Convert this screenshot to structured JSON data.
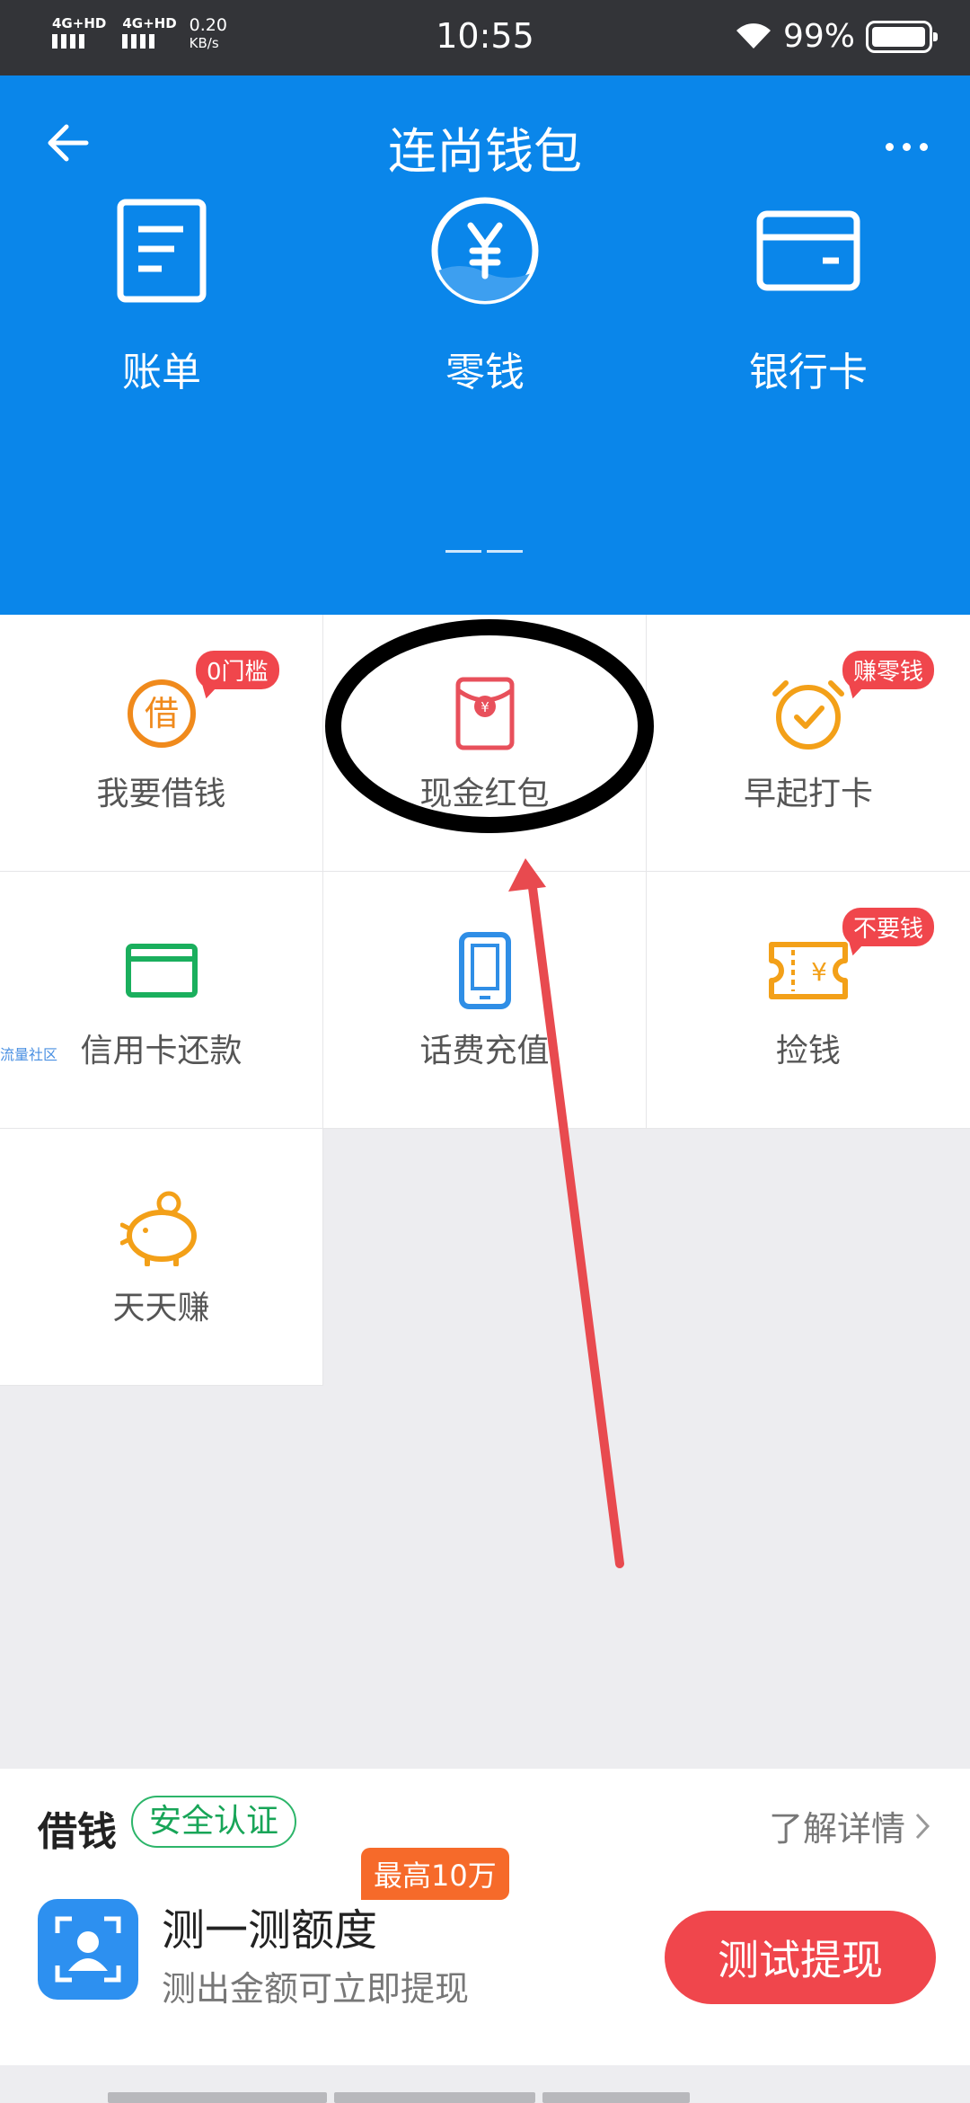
{
  "status_bar": {
    "time": "10:55",
    "net1": "4G+HD",
    "net2": "4G+HD",
    "speed": "0.20",
    "speed_unit": "KB/s",
    "battery": "99%",
    "battery_level": 0.99
  },
  "header": {
    "title": "连尚钱包",
    "items": [
      {
        "label": "账单",
        "icon": "bill-icon"
      },
      {
        "label": "零钱",
        "icon": "yuan-coin-icon"
      },
      {
        "label": "银行卡",
        "icon": "bank-card-icon"
      }
    ]
  },
  "grid": {
    "items": [
      {
        "label": "我要借钱",
        "icon": "borrow-icon",
        "badge": "0门槛",
        "color": "#f08a1c"
      },
      {
        "label": "现金红包",
        "icon": "red-envelope-icon",
        "badge": "",
        "color": "#e8505b"
      },
      {
        "label": "早起打卡",
        "icon": "alarm-clock-icon",
        "badge": "赚零钱",
        "color": "#f3a018"
      },
      {
        "label": "信用卡还款",
        "icon": "credit-card-icon",
        "badge": "",
        "color": "#1aaf5d"
      },
      {
        "label": "话费充值",
        "icon": "phone-icon",
        "badge": "",
        "color": "#2f8ee6"
      },
      {
        "label": "捡钱",
        "icon": "ticket-icon",
        "badge": "不要钱",
        "color": "#f3a018"
      },
      {
        "label": "天天赚",
        "icon": "piggy-bank-icon",
        "badge": "",
        "color": "#f3a018"
      }
    ],
    "side_note": "流量社区"
  },
  "promo": {
    "title": "借钱",
    "tag": "安全认证",
    "more": "了解详情",
    "main": "测一测额度",
    "sub": "测出金额可立即提现",
    "badge": "最高10万",
    "button": "测试提现"
  },
  "colors": {
    "primary": "#0a86ea",
    "danger": "#f0464c",
    "success": "#18a558"
  }
}
